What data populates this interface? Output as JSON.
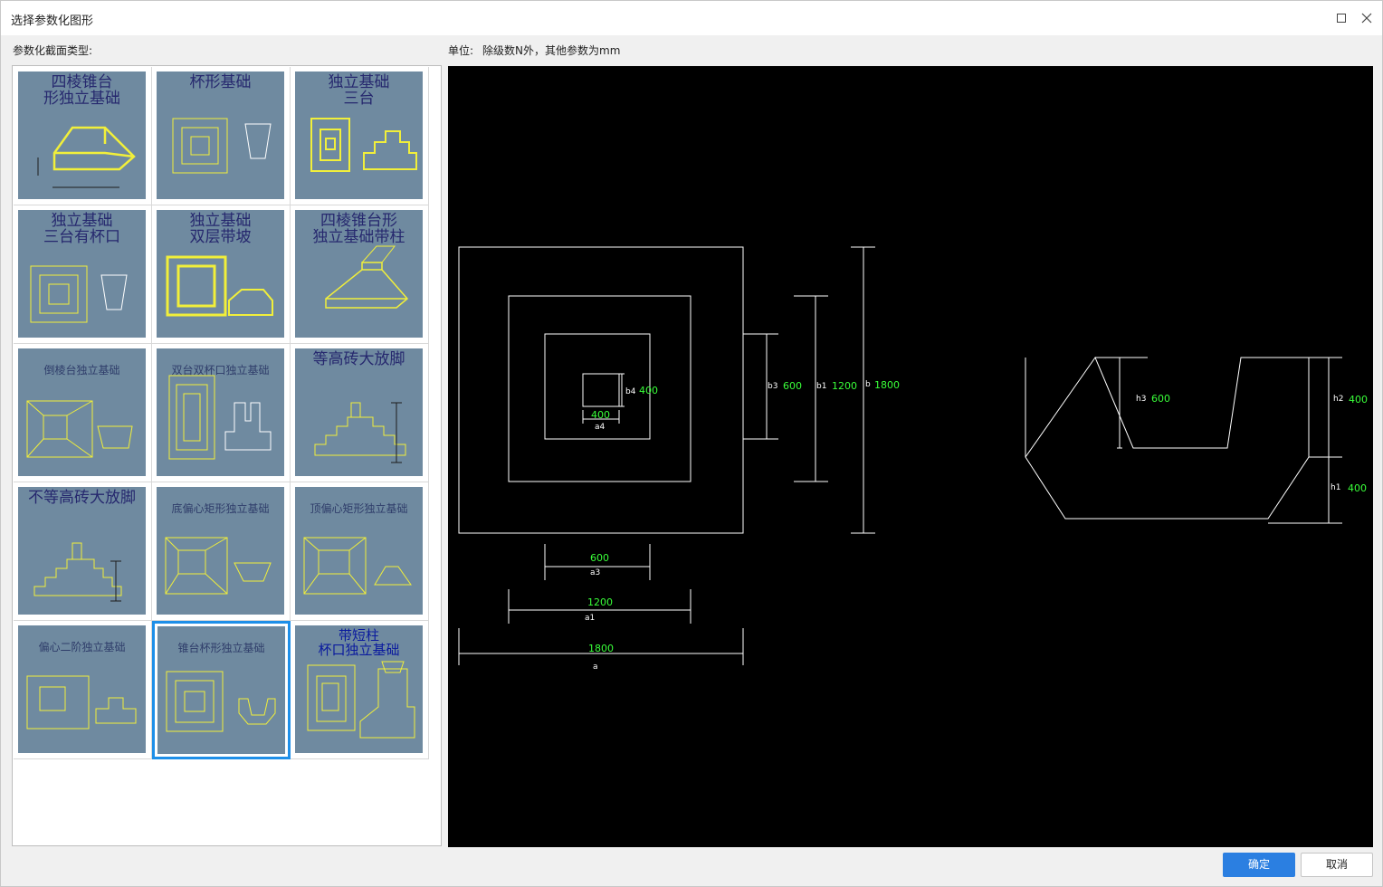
{
  "window": {
    "title": "选择参数化图形"
  },
  "labels": {
    "section_type": "参数化截面类型:",
    "unit_prefix": "单位:",
    "unit_text": "除级数N外，其他参数为mm"
  },
  "gallery": {
    "items": [
      {
        "title": "四棱锥台形独立基础",
        "title_lines": [
          "四棱锥台",
          "形独立基础"
        ],
        "selected": false
      },
      {
        "title": "杯形基础",
        "title_lines": [
          "杯形基础"
        ],
        "selected": false
      },
      {
        "title": "独立基础三台",
        "title_lines": [
          "独立基础",
          "三台"
        ],
        "selected": false
      },
      {
        "title": "独立基础三台有杯口",
        "title_lines": [
          "独立基础",
          "三台有杯口"
        ],
        "selected": false
      },
      {
        "title": "独立基础双层带坡",
        "title_lines": [
          "独立基础",
          "双层带坡"
        ],
        "selected": false
      },
      {
        "title": "四棱锥台形独立基础带柱",
        "title_lines": [
          "四棱锥台形",
          "独立基础带柱"
        ],
        "selected": false
      },
      {
        "title": "倒棱台独立基础",
        "title_lines": [
          "倒棱台独立基础"
        ],
        "selected": false
      },
      {
        "title": "双台双杯口独立基础",
        "title_lines": [
          "双台双杯口独立基础"
        ],
        "selected": false
      },
      {
        "title": "等高砖大放脚",
        "title_lines": [
          "等高砖大放脚"
        ],
        "selected": false
      },
      {
        "title": "不等高砖大放脚",
        "title_lines": [
          "不等高砖大放脚"
        ],
        "selected": false
      },
      {
        "title": "底偏心矩形独立基础",
        "title_lines": [
          "底偏心矩形独立基础"
        ],
        "selected": false
      },
      {
        "title": "顶偏心矩形独立基础",
        "title_lines": [
          "顶偏心矩形独立基础"
        ],
        "selected": false
      },
      {
        "title": "偏心二阶独立基础",
        "title_lines": [
          "偏心二阶独立基础"
        ],
        "selected": false
      },
      {
        "title": "锥台杯形独立基础",
        "title_lines": [
          "锥台杯形独立基础"
        ],
        "selected": true
      },
      {
        "title": "带短柱杯口独立基础",
        "title_lines": [
          "带短柱",
          "杯口独立基础"
        ],
        "selected": false
      }
    ]
  },
  "preview": {
    "plan_dims": {
      "a": {
        "label": "a",
        "value": "1800"
      },
      "a1": {
        "label": "a1",
        "value": "1200"
      },
      "a3": {
        "label": "a3",
        "value": "600"
      },
      "a4": {
        "label": "a4",
        "value": "400"
      },
      "b": {
        "label": "b",
        "value": "1800"
      },
      "b1": {
        "label": "b1",
        "value": "1200"
      },
      "b3": {
        "label": "b3",
        "value": "600"
      },
      "b4": {
        "label": "b4",
        "value": "400"
      }
    },
    "section_dims": {
      "h1": {
        "label": "h1",
        "value": "400"
      },
      "h2": {
        "label": "h2",
        "value": "400"
      },
      "h3": {
        "label": "h3",
        "value": "600"
      }
    }
  },
  "buttons": {
    "ok": "确定",
    "cancel": "取消"
  },
  "colors": {
    "accent": "#2b7fe1",
    "selection": "#1e8fe8",
    "thumb_bg": "#6f8aa0",
    "dim_value": "#39ff39"
  },
  "icons": {
    "maximize": "maximize-icon",
    "close": "close-icon"
  }
}
